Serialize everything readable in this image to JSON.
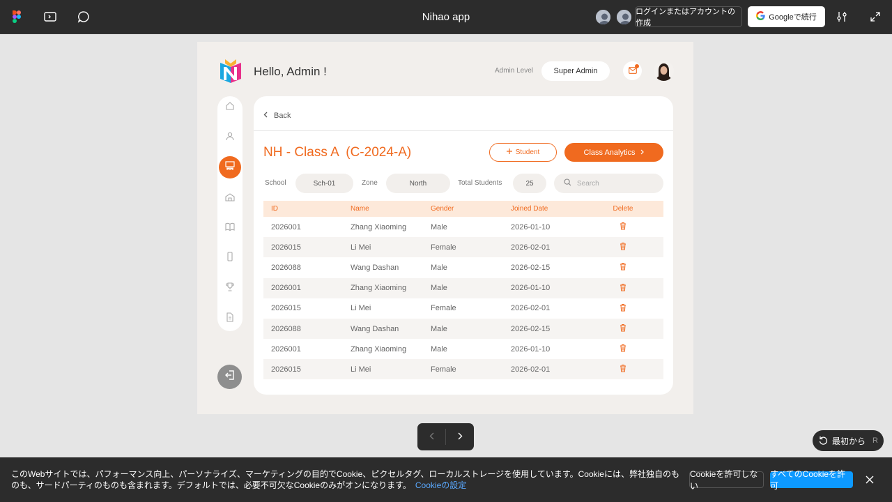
{
  "topbar": {
    "title": "Nihao app",
    "login_label": "ログインまたはアカウントの作成",
    "google_label": "Googleで続行"
  },
  "app": {
    "greeting": "Hello, Admin !",
    "admin_level_label": "Admin Level",
    "admin_level_value": "Super Admin",
    "back_label": "Back",
    "class_title": "NH - Class A  (C-2024-A)",
    "add_student_label": "Student",
    "analytics_label": "Class Analytics",
    "filters": {
      "school_label": "School",
      "school_value": "Sch-01",
      "zone_label": "Zone",
      "zone_value": "North",
      "total_label": "Total Students",
      "total_value": "25",
      "search_placeholder": "Search"
    },
    "table": {
      "headers": [
        "ID",
        "Name",
        "Gender",
        "Joined Date",
        "Delete"
      ],
      "rows": [
        {
          "id": "2026001",
          "name": "Zhang Xiaoming",
          "gender": "Male",
          "date": "2026-01-10"
        },
        {
          "id": "2026015",
          "name": "Li Mei",
          "gender": "Female",
          "date": "2026-02-01"
        },
        {
          "id": "2026088",
          "name": "Wang Dashan",
          "gender": "Male",
          "date": "2026-02-15"
        },
        {
          "id": "2026001",
          "name": "Zhang Xiaoming",
          "gender": "Male",
          "date": "2026-01-10"
        },
        {
          "id": "2026015",
          "name": "Li Mei",
          "gender": "Female",
          "date": "2026-02-01"
        },
        {
          "id": "2026088",
          "name": "Wang Dashan",
          "gender": "Male",
          "date": "2026-02-15"
        },
        {
          "id": "2026001",
          "name": "Zhang Xiaoming",
          "gender": "Male",
          "date": "2026-01-10"
        },
        {
          "id": "2026015",
          "name": "Li Mei",
          "gender": "Female",
          "date": "2026-02-01"
        }
      ]
    },
    "sidebar_icons": [
      "home-icon",
      "user-icon",
      "classroom-icon",
      "school-icon",
      "book-icon",
      "phone-icon",
      "trophy-icon",
      "document-icon"
    ],
    "accent_color": "#f06a1f"
  },
  "restart": {
    "label": "最初から",
    "key": "R"
  },
  "cookie": {
    "text": "このWebサイトでは、パフォーマンス向上、パーソナライズ、マーケティングの目的でCookie、ピクセルタグ、ローカルストレージを使用しています。Cookieには、弊社独自のものも、サードパーティのものも含まれます。デフォルトでは、必要不可欠なCookieのみがオンになります。",
    "link": "Cookieの設定",
    "deny": "Cookieを許可しない",
    "allow": "すべてのCookieを許可"
  }
}
